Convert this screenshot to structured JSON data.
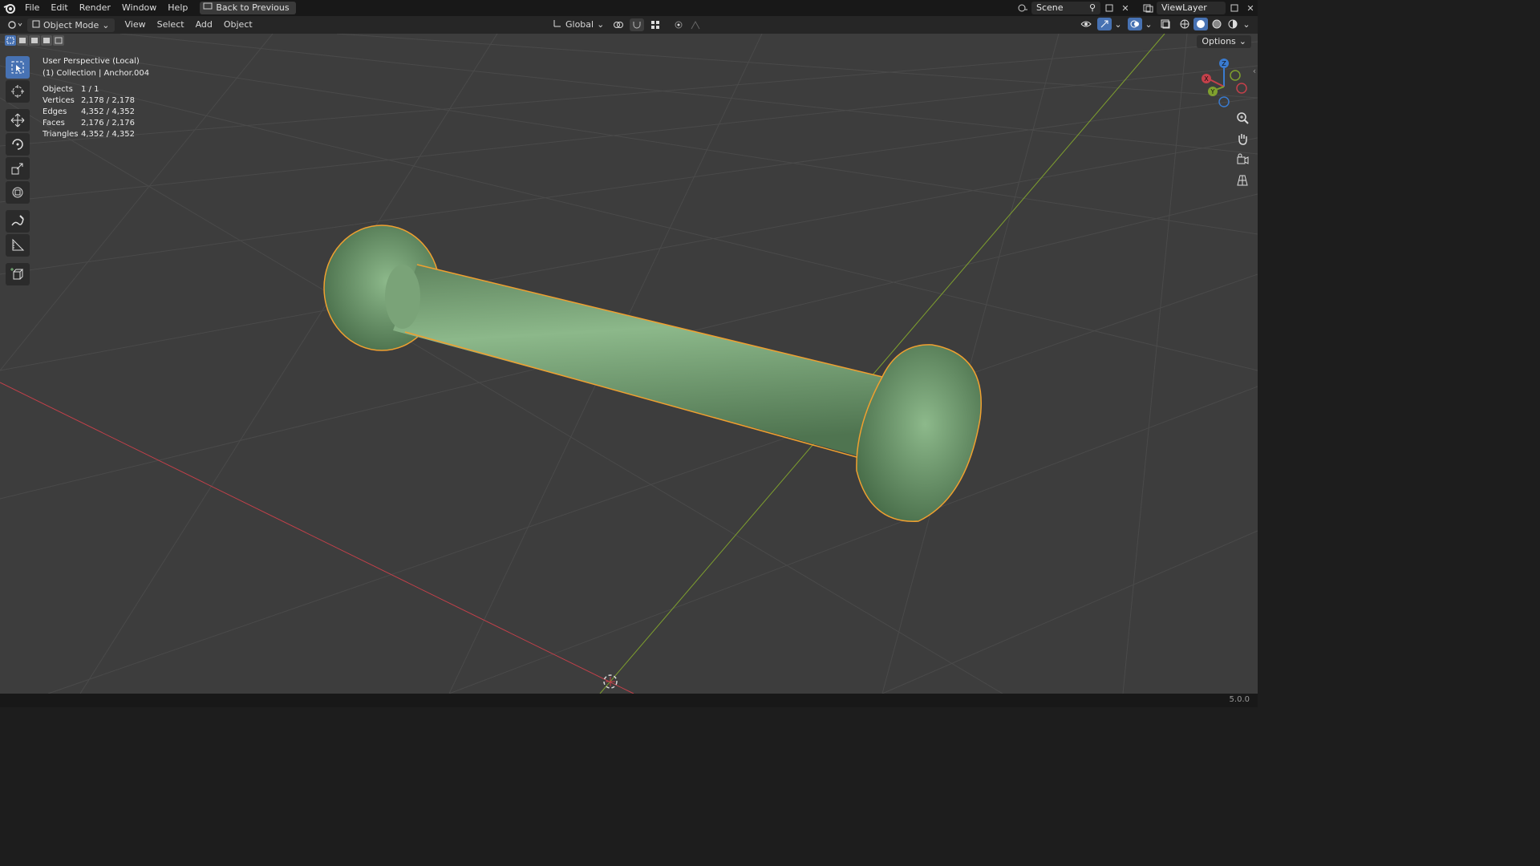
{
  "menubar": {
    "items": [
      "File",
      "Edit",
      "Render",
      "Window",
      "Help"
    ],
    "back_button": "Back to Previous",
    "scene_name": "Scene",
    "view_layer": "ViewLayer"
  },
  "header": {
    "mode": "Object Mode",
    "menus": [
      "View",
      "Select",
      "Add",
      "Object"
    ],
    "transform_orientation": "Global"
  },
  "viewport": {
    "perspective_label": "User Perspective (Local)",
    "collection_label": "(1) Collection | Anchor.004",
    "stats": [
      {
        "label": "Objects",
        "value": "1 / 1"
      },
      {
        "label": "Vertices",
        "value": "2,178 / 2,178"
      },
      {
        "label": "Edges",
        "value": "4,352 / 4,352"
      },
      {
        "label": "Faces",
        "value": "2,176 / 2,176"
      },
      {
        "label": "Triangles",
        "value": "4,352 / 4,352"
      }
    ],
    "options_label": "Options",
    "gizmo": {
      "x": "X",
      "y": "Y",
      "z": "Z"
    },
    "object_color": "#7fa87f",
    "selection_outline": "#f0a030"
  },
  "statusbar": {
    "version": "5.0.0"
  },
  "colors": {
    "axis_x": "#c4404a",
    "axis_y": "#7fa02e",
    "accent": "#4772b3"
  },
  "icons": [
    "blender-logo-icon",
    "select-box-icon",
    "cursor-icon",
    "move-icon",
    "rotate-icon",
    "scale-icon",
    "transform-icon",
    "annotate-icon",
    "measure-icon",
    "add-cube-icon",
    "zoom-icon",
    "pan-hand-icon",
    "camera-icon",
    "grid-icon"
  ]
}
